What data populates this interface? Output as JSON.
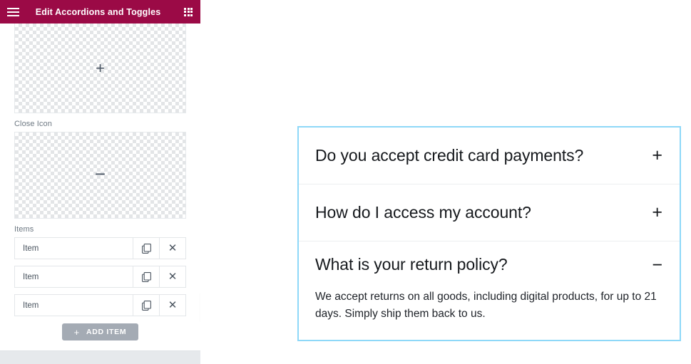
{
  "panel": {
    "header": {
      "title": "Edit Accordions and Toggles",
      "menu_icon": "hamburger-icon",
      "apps_icon": "apps-grid-icon",
      "background_color": "#9b0a46"
    },
    "controls": {
      "open_icon": {
        "glyph": "+",
        "icon_name": "plus-icon"
      },
      "close_icon": {
        "label": "Close Icon",
        "glyph": "−",
        "icon_name": "minus-icon"
      },
      "items_label": "Items",
      "items": [
        {
          "title": "Item",
          "duplicate_icon": "duplicate-icon",
          "remove_icon": "close-icon"
        },
        {
          "title": "Item",
          "duplicate_icon": "duplicate-icon",
          "remove_icon": "close-icon"
        },
        {
          "title": "Item",
          "duplicate_icon": "duplicate-icon",
          "remove_icon": "close-icon"
        }
      ],
      "add_item_button": {
        "label": "ADD ITEM",
        "plus": "+",
        "background_color": "#a4abb4"
      }
    },
    "collapse_handle": {
      "glyph": "‹",
      "icon_name": "chevron-left-icon"
    }
  },
  "canvas": {
    "accordion": {
      "border_color": "#8ed8f8",
      "items": [
        {
          "title": "Do you accept credit card payments?",
          "toggle": "+",
          "expanded": false,
          "content": ""
        },
        {
          "title": "How do I access my account?",
          "toggle": "+",
          "expanded": false,
          "content": ""
        },
        {
          "title": "What is your return policy?",
          "toggle": "−",
          "expanded": true,
          "content": "We accept returns on all goods, including digital products, for up to 21 days. Simply ship them back to us."
        }
      ]
    }
  }
}
